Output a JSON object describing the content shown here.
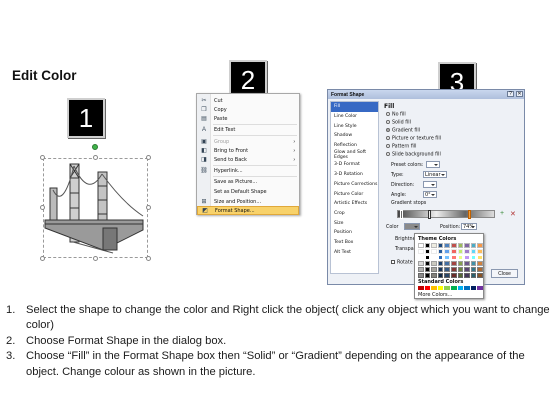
{
  "heading": "Edit Color",
  "step_badges": [
    "1",
    "2",
    "3"
  ],
  "context_menu": {
    "items": [
      {
        "icon": "cut-icon",
        "label": "Cut",
        "disabled": false
      },
      {
        "icon": "copy-icon",
        "label": "Copy",
        "disabled": false
      },
      {
        "icon": "paste-icon",
        "label": "Paste",
        "disabled": false
      },
      {
        "icon": "edit-text-icon",
        "label": "Edit Text",
        "disabled": false
      },
      {
        "icon": "group-icon",
        "label": "Group",
        "disabled": true,
        "submenu": true
      },
      {
        "icon": "bring-front-icon",
        "label": "Bring to Front",
        "disabled": false,
        "submenu": true
      },
      {
        "icon": "send-back-icon",
        "label": "Send to Back",
        "disabled": false,
        "submenu": true
      },
      {
        "icon": "hyperlink-icon",
        "label": "Hyperlink...",
        "disabled": false
      },
      {
        "icon": "",
        "label": "Save as Picture...",
        "disabled": false
      },
      {
        "icon": "",
        "label": "Set as Default Shape",
        "disabled": false
      },
      {
        "icon": "size-icon",
        "label": "Size and Position...",
        "disabled": false
      },
      {
        "icon": "format-icon",
        "label": "Format Shape...",
        "disabled": false,
        "highlighted": true
      }
    ]
  },
  "format_dialog": {
    "title": "Format Shape",
    "categories": [
      "Fill",
      "Line Color",
      "Line Style",
      "Shadow",
      "Reflection",
      "Glow and Soft Edges",
      "3-D Format",
      "3-D Rotation",
      "Picture Corrections",
      "Picture Color",
      "Artistic Effects",
      "Crop",
      "Size",
      "Position",
      "Text Box",
      "Alt Text"
    ],
    "selected_category": "Fill",
    "section_title": "Fill",
    "fill_options": [
      "No fill",
      "Solid fill",
      "Gradient fill",
      "Picture or texture fill",
      "Pattern fill",
      "Slide background fill"
    ],
    "selected_fill": "Gradient fill",
    "preset_colors_label": "Preset colors:",
    "type_label": "Type:",
    "type_value": "Linear",
    "direction_label": "Direction:",
    "angle_label": "Angle:",
    "angle_value": "0°",
    "gradient_stops_label": "Gradient stops",
    "color_label": "Color",
    "position_label": "Position:",
    "position_value": "74%",
    "brightness_label": "Brightness:",
    "transparency_label": "Transparency:",
    "rotate_label": "Rotate with shape",
    "theme_colors_label": "Theme Colors",
    "standard_colors_label": "Standard Colors",
    "more_colors_label": "More Colors...",
    "close_label": "Close"
  },
  "instructions": [
    {
      "num": "1.",
      "text": "Select the shape to change the color and Right click the object( click any object which you want to change color)"
    },
    {
      "num": "2.",
      "text": "Choose Format Shape in the dialog box."
    },
    {
      "num": "3.",
      "text": "Choose “Fill” in the Format Shape box then “Solid” or “Gradient” depending on the appearance of the object. Change colour as shown in the picture."
    }
  ]
}
